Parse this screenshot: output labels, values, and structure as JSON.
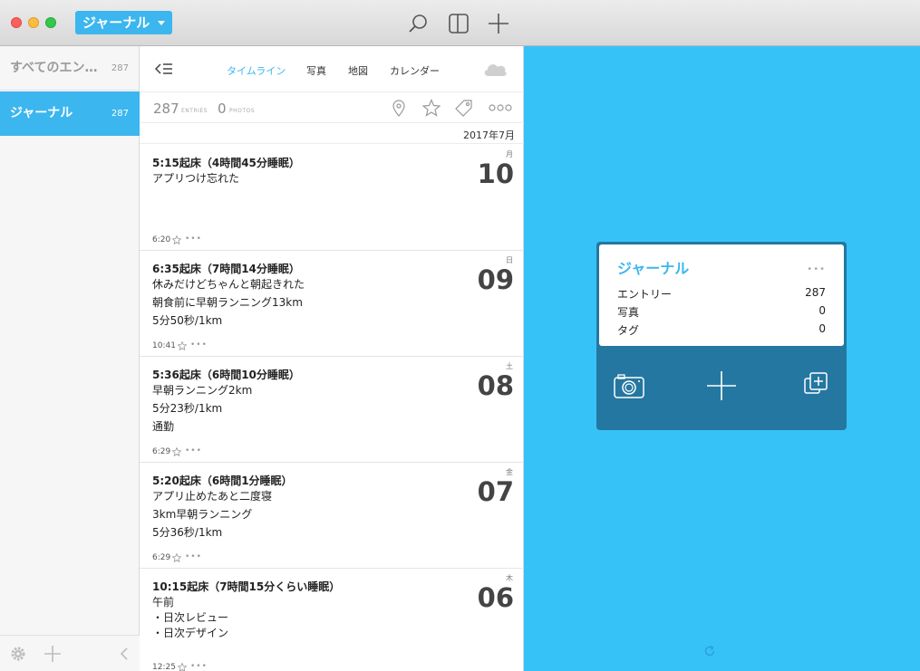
{
  "titlebar": {
    "journal_label": "ジャーナル"
  },
  "sidebar": {
    "items": [
      {
        "label": "すべてのエン…",
        "count": "287"
      },
      {
        "label": "ジャーナル",
        "count": "287"
      }
    ]
  },
  "timeline": {
    "tabs": [
      "タイムライン",
      "写真",
      "地図",
      "カレンダー"
    ],
    "active_tab": "タイムライン",
    "stats": {
      "entries_count": "287",
      "entries_label": "ENTRIES",
      "photos_count": "0",
      "photos_label": "PHOTOS"
    },
    "month_header": "2017年7月",
    "entries": [
      {
        "title": "5:15起床（4時間45分睡眠）",
        "lines": [
          "アプリつけ忘れた"
        ],
        "dow": "月",
        "day": "10",
        "time": "6:20"
      },
      {
        "title": "6:35起床（7時間14分睡眠）",
        "lines": [
          "休みだけどちゃんと朝起きれた",
          "朝食前に早朝ランニング13km",
          "5分50秒/1km"
        ],
        "dow": "日",
        "day": "09",
        "time": "10:41"
      },
      {
        "title": "5:36起床（6時間10分睡眠）",
        "lines": [
          "早朝ランニング2km",
          "5分23秒/1km",
          "通勤"
        ],
        "dow": "土",
        "day": "08",
        "time": "6:29"
      },
      {
        "title": "5:20起床（6時間1分睡眠）",
        "lines": [
          "アプリ止めたあと二度寝",
          "3km早朝ランニング",
          "5分36秒/1km"
        ],
        "dow": "金",
        "day": "07",
        "time": "6:29"
      },
      {
        "title": "10:15起床（7時間15分くらい睡眠）",
        "lines": [
          "午前",
          "・日次レビュー",
          "・日次デザイン"
        ],
        "dow": "木",
        "day": "06",
        "time": "12:25"
      }
    ],
    "more_glyph": "•••"
  },
  "card": {
    "title": "ジャーナル",
    "more_glyph": "•••",
    "rows": [
      {
        "label": "エントリー",
        "value": "287"
      },
      {
        "label": "写真",
        "value": "0"
      },
      {
        "label": "タグ",
        "value": "0"
      }
    ]
  },
  "colors": {
    "accent": "#3bb6ef",
    "right_bg": "#36c2f7",
    "card_bg": "#2477a0"
  }
}
